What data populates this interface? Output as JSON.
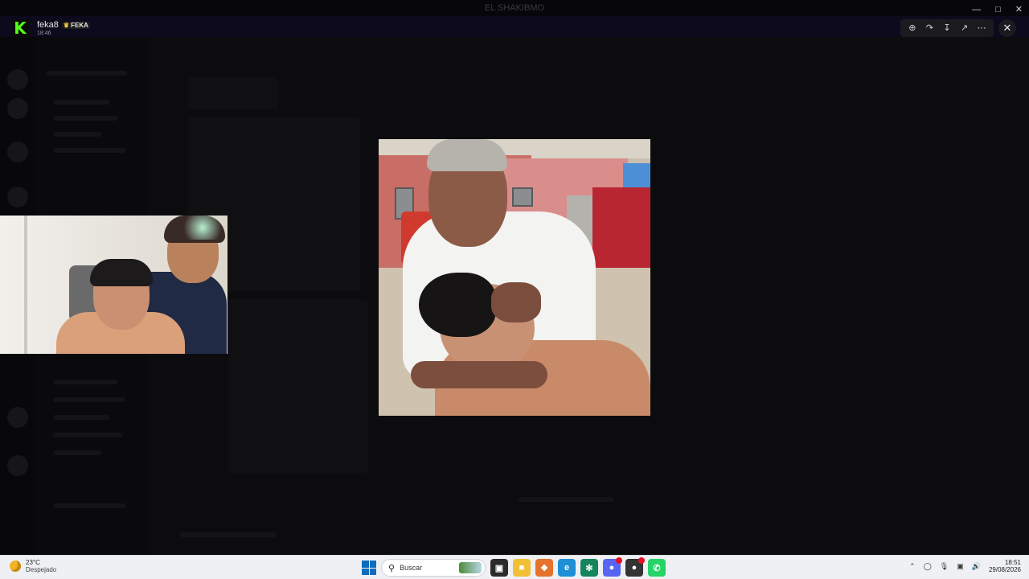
{
  "notification": {
    "username": "feka8",
    "badge_label": "FEKA",
    "time": "18:46"
  },
  "window": {
    "title": "EL SHAKIBMO"
  },
  "viewer_toolbar": {
    "zoom_icon": "zoom-in-icon",
    "forward_icon": "share-forward-icon",
    "download_icon": "download-icon",
    "open_icon": "open-external-icon",
    "more_icon": "more-options-icon",
    "close_icon": "close-icon"
  },
  "taskbar": {
    "weather_temp": "23°C",
    "weather_desc": "Despejado",
    "search_placeholder": "Buscar",
    "clock_time": "18:51",
    "clock_date": "29/08/2026",
    "apps": [
      {
        "name": "file-explorer-icon",
        "color": "#f2c037"
      },
      {
        "name": "edge-icon",
        "color": "#1f8fd6"
      },
      {
        "name": "chatgpt-icon",
        "color": "#14855c"
      },
      {
        "name": "discord-icon",
        "color": "#5865f2"
      },
      {
        "name": "app-icon",
        "color": "#333333"
      },
      {
        "name": "whatsapp-icon",
        "color": "#25d366"
      }
    ]
  }
}
